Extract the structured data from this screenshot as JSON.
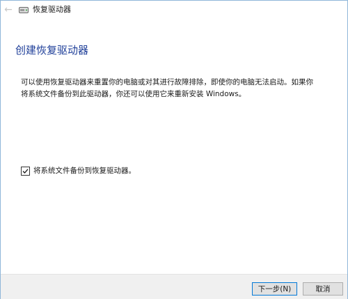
{
  "window": {
    "title": "恢复驱动器",
    "back_glyph": "←"
  },
  "main": {
    "heading": "创建恢复驱动器",
    "description": "可以使用恢复驱动器来重置你的电脑或对其进行故障排除，即使你的电脑无法启动。如果你将系统文件备份到此驱动器，你还可以使用它来重新安装 Windows。",
    "backup_checkbox": {
      "label": "将系统文件备份到恢复驱动器。",
      "checked": true
    }
  },
  "footer": {
    "next_label": "下一步(N)",
    "cancel_label": "取消"
  },
  "colors": {
    "heading": "#1f3f99",
    "border": "#8fb6d9",
    "footer_bg": "#f0f0f0",
    "primary_button_border": "#0078d7"
  },
  "icons": {
    "back": "back-arrow-icon",
    "app": "drive-icon",
    "checkbox": "checkmark-icon"
  }
}
